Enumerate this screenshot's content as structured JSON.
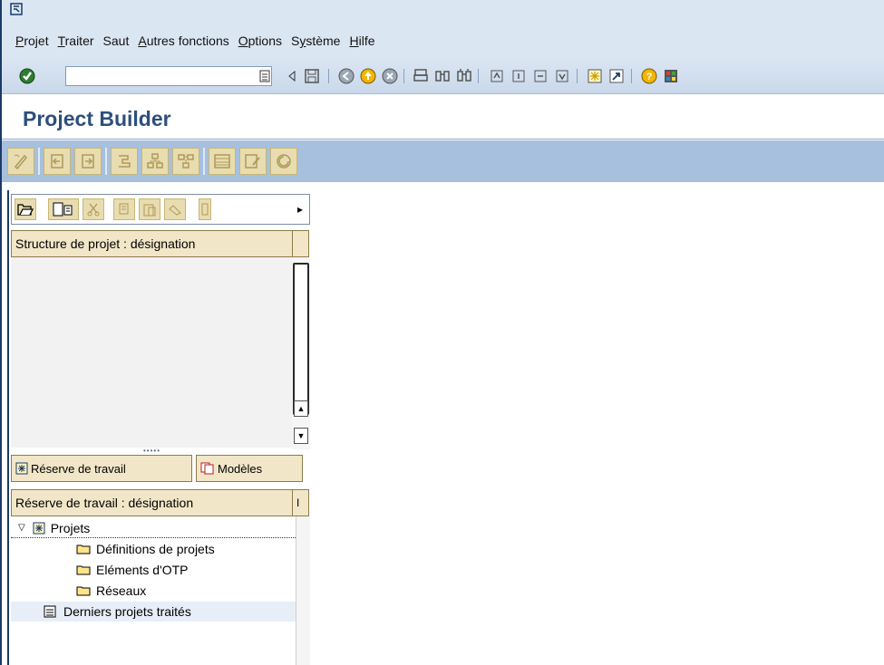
{
  "menu": {
    "items": [
      {
        "label": "Projet",
        "u": "P"
      },
      {
        "label": "Traiter",
        "u": "T"
      },
      {
        "label": "Saut",
        "u": ""
      },
      {
        "label": "Autres fonctions",
        "u": "A"
      },
      {
        "label": "Options",
        "u": "O"
      },
      {
        "label": "Système",
        "u": "y"
      },
      {
        "label": "Hilfe",
        "u": "H"
      }
    ]
  },
  "toolbar": {
    "command_value": ""
  },
  "page": {
    "title": "Project Builder"
  },
  "structure": {
    "header": "Structure de projet : désignation"
  },
  "tabs": {
    "worklist": "Réserve de travail",
    "templates": "Modèles"
  },
  "worklist": {
    "header": "Réserve de travail : désignation",
    "header_end": "I",
    "tree": {
      "root": "Projets",
      "children": [
        "Définitions de projets",
        "Eléments d'OTP",
        "Réseaux"
      ],
      "last": "Derniers projets traités"
    }
  },
  "colors": {
    "title": "#2d4f7c",
    "app_toolbar": "#a6c0de",
    "header_bg": "#f2e6c8",
    "menubar": "#dbe6f3"
  }
}
